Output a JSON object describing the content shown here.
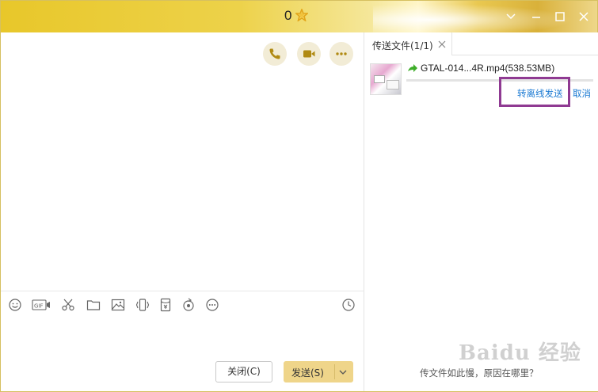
{
  "titlebar": {
    "score": "0",
    "colors": {
      "gold": "#e8c72a",
      "star": "#e3a51a"
    },
    "window_controls": [
      "chevron-down-icon",
      "minimize-icon",
      "maximize-icon",
      "close-icon"
    ]
  },
  "chat": {
    "call_buttons": [
      "phone-icon",
      "video-call-icon",
      "more-icon"
    ],
    "toolbar_icons": [
      "emoji-icon",
      "gif-icon",
      "scissors-icon",
      "folder-icon",
      "image-icon",
      "shake-icon",
      "red-packet-icon",
      "music-icon",
      "more-icon",
      "history-clock-icon"
    ],
    "close_button": "关闭(C)",
    "send_button": "发送(S)"
  },
  "transfer": {
    "tab_label": "传送文件(1/1)",
    "file_name": "GTAL-014...4R.mp4(538.53MB)",
    "progress": 0,
    "offline_send": "转离线发送",
    "cancel": "取消",
    "tip": "传文件如此慢，原因在哪里？",
    "accent": "#1d7bd3",
    "highlight_color": "#8f3a92"
  },
  "watermark": "Baidu 经验"
}
